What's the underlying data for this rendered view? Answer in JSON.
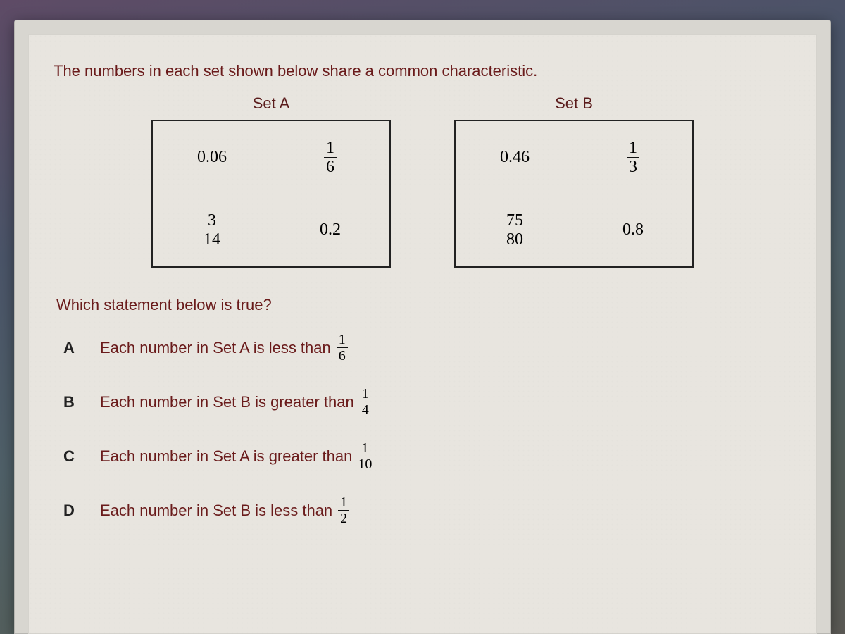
{
  "intro": "The numbers in each set shown below share a common characteristic.",
  "sets": {
    "a": {
      "title": "Set A",
      "cells": {
        "tl": {
          "type": "dec",
          "value": "0.06"
        },
        "tr": {
          "type": "frac",
          "n": "1",
          "d": "6"
        },
        "bl": {
          "type": "frac",
          "n": "3",
          "d": "14"
        },
        "br": {
          "type": "dec",
          "value": "0.2"
        }
      }
    },
    "b": {
      "title": "Set B",
      "cells": {
        "tl": {
          "type": "dec",
          "value": "0.46"
        },
        "tr": {
          "type": "frac",
          "n": "1",
          "d": "3"
        },
        "bl": {
          "type": "frac",
          "n": "75",
          "d": "80"
        },
        "br": {
          "type": "dec",
          "value": "0.8"
        }
      }
    }
  },
  "question": "Which statement below is true?",
  "options": [
    {
      "letter": "A",
      "text": "Each number in Set A is less than",
      "frac": {
        "n": "1",
        "d": "6"
      }
    },
    {
      "letter": "B",
      "text": "Each number in Set B is greater than",
      "frac": {
        "n": "1",
        "d": "4"
      }
    },
    {
      "letter": "C",
      "text": "Each number in Set A is greater than",
      "frac": {
        "n": "1",
        "d": "10"
      }
    },
    {
      "letter": "D",
      "text": "Each number in Set B is less than",
      "frac": {
        "n": "1",
        "d": "2"
      }
    }
  ]
}
